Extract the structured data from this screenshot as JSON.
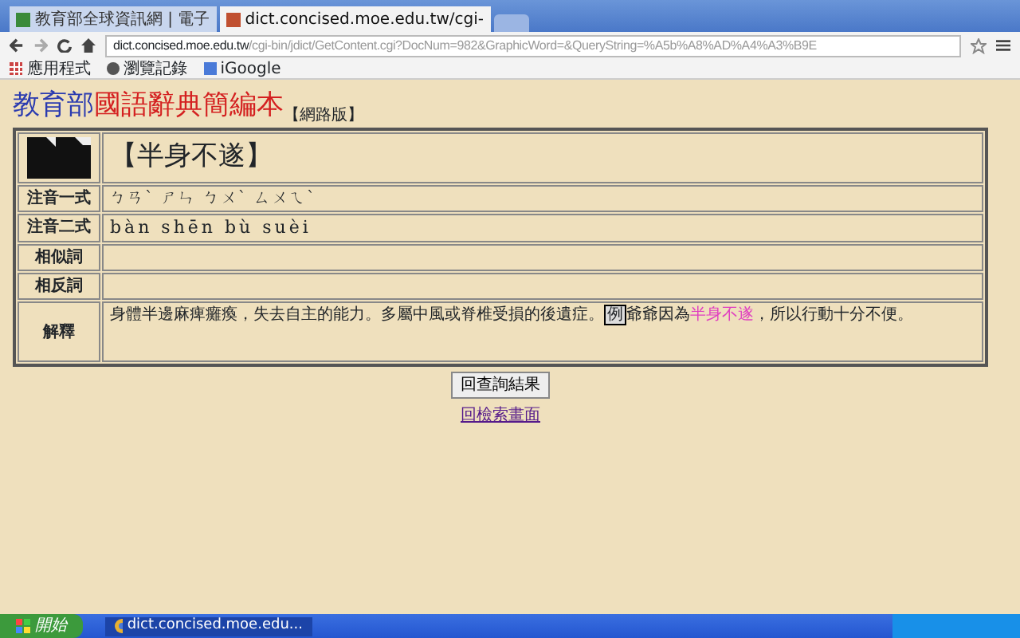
{
  "browser": {
    "tabs": [
      {
        "label": "教育部全球資訊網 | 電子",
        "selected": false
      },
      {
        "label": "dict.concised.moe.edu.tw/cgi-",
        "selected": true
      }
    ],
    "address": {
      "host": "dict.concised.moe.edu.tw",
      "path": "/cgi-bin/jdict/GetContent.cgi?DocNum=982&GraphicWord=&QueryString=%A5b%A8%AD%A4%A3%B9E"
    },
    "bookmarks": [
      {
        "kind": "apps",
        "label": "應用程式"
      },
      {
        "kind": "history",
        "label": "瀏覽記錄"
      },
      {
        "kind": "page",
        "label": "iGoogle"
      }
    ]
  },
  "page": {
    "title": {
      "org": "教育部",
      "name": "國語辭典簡編本",
      "edition": "【網路版】"
    },
    "entry": {
      "word": "【半身不遂】",
      "rows": [
        {
          "label": "注音一式",
          "value": "ㄅㄢˋ ㄕㄣ ㄅㄨˋ ㄙㄨㄟˋ",
          "kind": "zhuyin"
        },
        {
          "label": "注音二式",
          "value": "bàn shēn bù suèi",
          "kind": "pinyin"
        },
        {
          "label": "相似詞",
          "kind": "plain"
        },
        {
          "label": "相反詞",
          "kind": "plain"
        },
        {
          "label": "解釋",
          "kind": "explanation",
          "definition": "身體半邊麻痺癱瘓，失去自主的能力。多屬中風或脊椎受損的後遺症。",
          "example_marker": "例",
          "example": [
            {
              "text": "爺爺因為",
              "highlighted": false
            },
            {
              "text": "半身不遂",
              "highlighted": true
            },
            {
              "text": "，所以行動十分不便。",
              "highlighted": false
            }
          ]
        }
      ]
    },
    "back_button": "回查詢結果",
    "back_link": "回檢索畫面"
  },
  "taskbar": {
    "start": "開始",
    "tasks": [
      {
        "label": "dict.concised.moe.edu...",
        "selected": true
      }
    ]
  }
}
